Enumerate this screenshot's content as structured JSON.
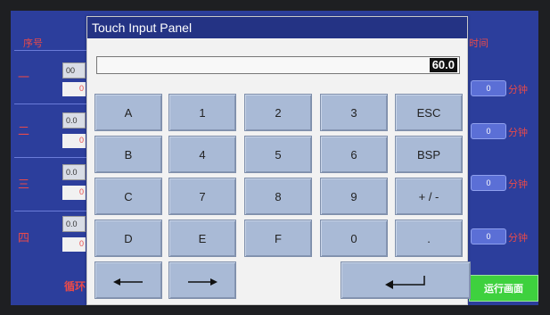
{
  "background": {
    "left_header": "序号",
    "right_header": "时间",
    "rows": [
      {
        "label": "一",
        "box_value": "00",
        "white_value": "0",
        "pill_value": "0",
        "unit": "分钟"
      },
      {
        "label": "二",
        "box_value": "0.0",
        "white_value": "0",
        "pill_value": "0",
        "unit": "分钟"
      },
      {
        "label": "三",
        "box_value": "0.0",
        "white_value": "0",
        "pill_value": "0",
        "unit": "分钟"
      },
      {
        "label": "四",
        "box_value": "0.0",
        "white_value": "0",
        "pill_value": "0",
        "unit": "分钟"
      }
    ],
    "bottom_left_text": "循环",
    "run_button_label": "运行画面"
  },
  "panel": {
    "title": "Touch Input Panel",
    "display_value": "60.0",
    "keys": {
      "a": "A",
      "one": "1",
      "two": "2",
      "three": "3",
      "esc": "ESC",
      "b": "B",
      "four": "4",
      "five": "5",
      "six": "6",
      "bsp": "BSP",
      "c": "C",
      "seven": "7",
      "eight": "8",
      "nine": "9",
      "sign": "+ / -",
      "d": "D",
      "e": "E",
      "f": "F",
      "zero": "0",
      "dot": "."
    },
    "icons": {
      "left": "arrow-left-icon",
      "right": "arrow-right-icon",
      "enter": "enter-icon"
    }
  }
}
